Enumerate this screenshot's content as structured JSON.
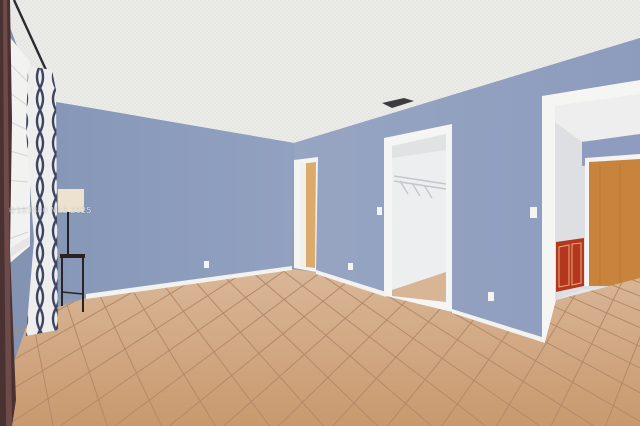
{
  "scene": {
    "description_label": "",
    "watermark": "©183840 MLS 2025"
  },
  "palette": {
    "wall_blue": "#8e9dbf",
    "ceiling": "#ebebe9",
    "floor_tile": "#d1a781",
    "grout": "#b58a66",
    "trim_white": "#f3f3f1",
    "wood_door": "#c8843d",
    "red_cabinet": "#b5361f"
  }
}
